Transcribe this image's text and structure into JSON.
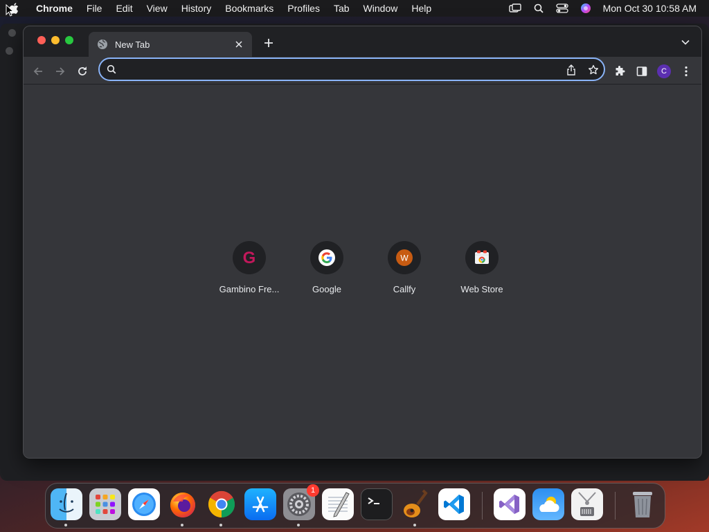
{
  "menubar": {
    "app_name": "Chrome",
    "items": [
      "File",
      "Edit",
      "View",
      "History",
      "Bookmarks",
      "Profiles",
      "Tab",
      "Window",
      "Help"
    ],
    "clock": "Mon Oct 30  10:58 AM"
  },
  "tab": {
    "title": "New Tab"
  },
  "omnibox": {
    "value": "",
    "placeholder": ""
  },
  "profile": {
    "initial": "C",
    "color": "#5b2fb0"
  },
  "shortcuts": [
    {
      "label": "Gambino Fre...",
      "icon": "gambino-icon"
    },
    {
      "label": "Google",
      "icon": "google-icon"
    },
    {
      "label": "Callfy",
      "icon": "callfy-icon"
    },
    {
      "label": "Web Store",
      "icon": "webstore-icon"
    }
  ],
  "dock": {
    "apps": [
      "Finder",
      "Launchpad",
      "Safari",
      "Firefox",
      "Chrome",
      "App Store",
      "System Settings",
      "TextEdit",
      "Terminal",
      "GarageBand",
      "Visual Studio Code",
      "Visual Studio",
      "Weather",
      "Archive Utility",
      "Trash"
    ],
    "settings_badge": "1"
  },
  "colors": {
    "accent": "#8ab4f8",
    "window_bg": "#35363a",
    "tabstrip_bg": "#202124"
  }
}
